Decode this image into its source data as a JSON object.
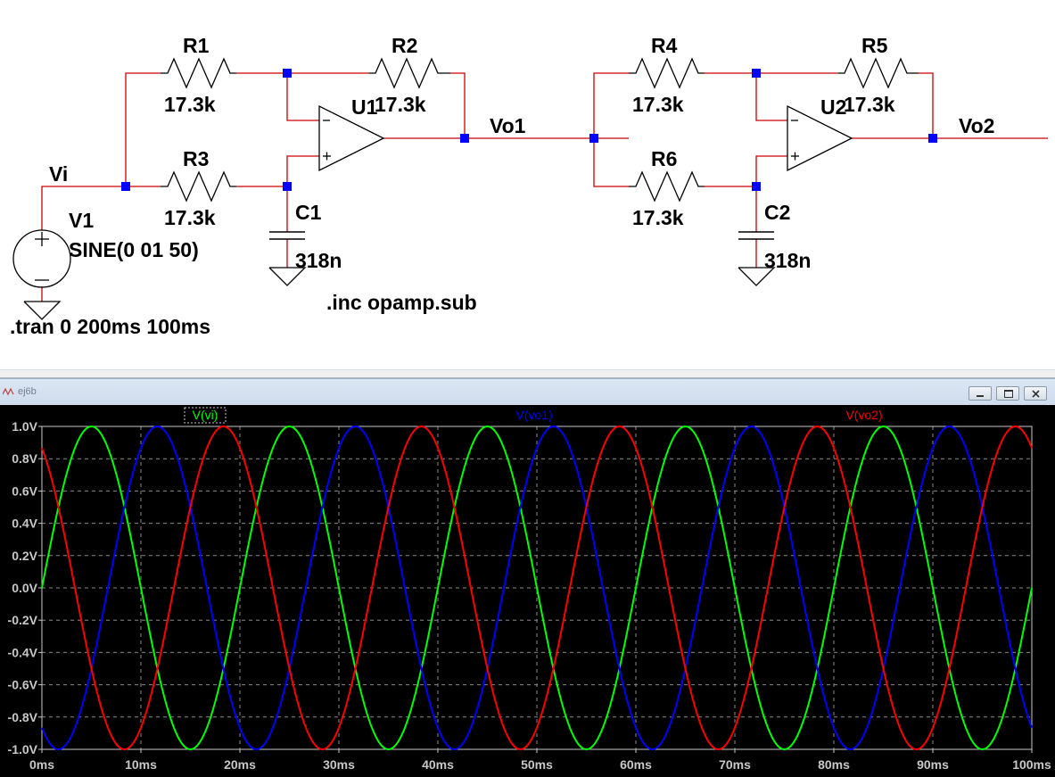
{
  "schematic": {
    "components": {
      "r1": {
        "name": "R1",
        "value": "17.3k"
      },
      "r2": {
        "name": "R2",
        "value": "17.3k"
      },
      "r3": {
        "name": "R3",
        "value": "17.3k"
      },
      "r4": {
        "name": "R4",
        "value": "17.3k"
      },
      "r5": {
        "name": "R5",
        "value": "17.3k"
      },
      "r6": {
        "name": "R6",
        "value": "17.3k"
      },
      "c1": {
        "name": "C1",
        "value": "318n"
      },
      "c2": {
        "name": "C2",
        "value": "318n"
      },
      "u1": {
        "name": "U1"
      },
      "u2": {
        "name": "U2"
      },
      "v1": {
        "name": "V1",
        "value": "SINE(0 01 50)"
      }
    },
    "nets": {
      "vi": "Vi",
      "vo1": "Vo1",
      "vo2": "Vo2"
    },
    "directives": {
      "tran": ".tran 0 200ms 100ms",
      "inc": ".inc opamp.sub"
    },
    "colors": {
      "wire": "#cc0000",
      "symbol": "#000000",
      "node": "#0000ff",
      "text": "#000000"
    }
  },
  "plot_window": {
    "title": "ej6b",
    "buttons": [
      "minimize-icon",
      "restore-icon",
      "close-icon"
    ]
  },
  "chart_data": {
    "type": "line",
    "background": "#000000",
    "grid": true,
    "xlabel": "",
    "ylabel": "",
    "x_ticks": [
      "0ms",
      "10ms",
      "20ms",
      "30ms",
      "40ms",
      "50ms",
      "60ms",
      "70ms",
      "80ms",
      "90ms",
      "100ms"
    ],
    "y_ticks": [
      "1.0V",
      "0.8V",
      "0.6V",
      "0.4V",
      "0.2V",
      "0.0V",
      "-0.2V",
      "-0.4V",
      "-0.6V",
      "-0.8V",
      "-1.0V"
    ],
    "xlim": [
      0,
      100
    ],
    "ylim": [
      -1.0,
      1.0
    ],
    "x_unit": "ms",
    "y_unit": "V",
    "series": [
      {
        "name": "V(vi)",
        "color": "#00ff00",
        "amplitude": 1.0,
        "frequency_hz": 50,
        "phase_deg": 0,
        "y_at_0": 0.0
      },
      {
        "name": "V(vo1)",
        "color": "#0000ff",
        "amplitude": 1.0,
        "frequency_hz": 50,
        "phase_deg": -120,
        "y_at_0": -0.866
      },
      {
        "name": "V(vo2)",
        "color": "#ff0000",
        "amplitude": 1.0,
        "frequency_hz": 50,
        "phase_deg": -240,
        "y_at_0": 0.866
      }
    ]
  }
}
